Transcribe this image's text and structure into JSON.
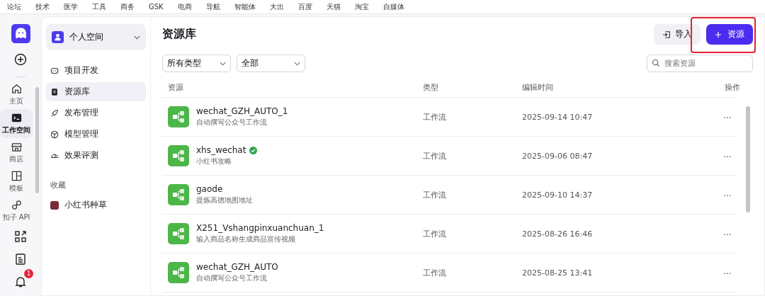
{
  "bookmarks": [
    "论坛",
    "技术",
    "医学",
    "工具",
    "商务",
    "GSK",
    "电商",
    "导航",
    "智能体",
    "大出",
    "百度",
    "天猫",
    "淘宝",
    "自媒体"
  ],
  "rail": {
    "items": [
      {
        "label": "主页",
        "selected": false
      },
      {
        "label": "工作空间",
        "selected": true
      },
      {
        "label": "商店",
        "selected": false
      },
      {
        "label": "模板",
        "selected": false
      },
      {
        "label": "扣子 API",
        "selected": false
      }
    ],
    "notification_count": "1"
  },
  "sidebar": {
    "space": "个人空间",
    "items": [
      {
        "label": "项目开发",
        "selected": false
      },
      {
        "label": "资源库",
        "selected": true
      },
      {
        "label": "发布管理",
        "selected": false
      },
      {
        "label": "模型管理",
        "selected": false
      },
      {
        "label": "效果评测",
        "selected": false
      }
    ],
    "favorites_title": "收藏",
    "favorites": [
      "小红书种草"
    ]
  },
  "main": {
    "title": "资源库",
    "import_button": "导入",
    "add_button": "资源",
    "add_button_highlighted": true,
    "filters": [
      "所有类型",
      "全部"
    ],
    "search": {
      "placeholder": "搜索资源"
    },
    "columns": [
      "资源",
      "类型",
      "编辑时间",
      "操作"
    ],
    "rows": [
      {
        "name": "wechat_GZH_AUTO_1",
        "verified": false,
        "description": "自动撰写公众号工作流",
        "type": "工作流",
        "edited": "2025-09-14 10:47",
        "action": "···"
      },
      {
        "name": "xhs_wechat",
        "verified": true,
        "description": "小红书攻略",
        "type": "工作流",
        "edited": "2025-09-06 08:47",
        "action": "···"
      },
      {
        "name": "gaode",
        "verified": false,
        "description": "提炼高德地图地址",
        "type": "工作流",
        "edited": "2025-09-10 14:37",
        "action": "···"
      },
      {
        "name": "X251_Vshangpinxuanchuan_1",
        "verified": false,
        "description": "输入商品名称生成商品宣传视频",
        "type": "工作流",
        "edited": "2025-08-26 16:46",
        "action": "···"
      },
      {
        "name": "wechat_GZH_AUTO",
        "verified": false,
        "description": "自动撰写公众号工作流",
        "type": "工作流",
        "edited": "2025-08-25 13:41",
        "action": "···"
      }
    ]
  }
}
